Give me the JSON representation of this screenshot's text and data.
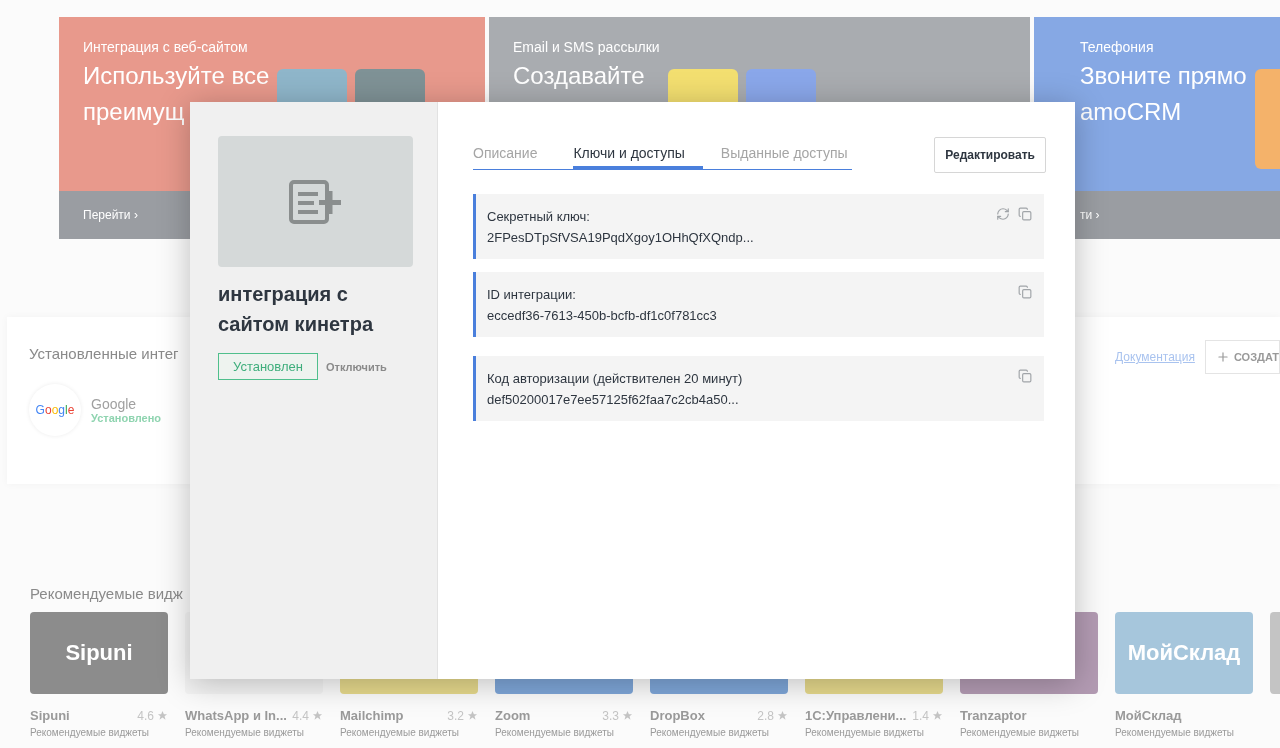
{
  "banners": [
    {
      "category": "Интеграция с веб-сайтом",
      "title_lines": [
        "Используйте все",
        "преимущ"
      ],
      "link": "Перейти ›",
      "color": "#e8998c",
      "logos": [
        {
          "color": "#8fb6ca"
        },
        {
          "color": "#7f9296"
        }
      ]
    },
    {
      "category": "Email и SMS рассылки",
      "title_lines": [
        "Создавайте"
      ],
      "color": "#a9acb0",
      "logos": [
        {
          "color": "#f3df70"
        },
        {
          "color": "#8aa7ea"
        }
      ]
    },
    {
      "category": "Телефония",
      "title_lines": [
        "Звоните прямо",
        "amoCRM"
      ],
      "link": "ти ›",
      "color": "#86a8e4",
      "logos": [
        {
          "color": "#f4b26a"
        }
      ]
    }
  ],
  "installed": {
    "title": "Установленные интег",
    "docs_link": "Документация",
    "create_button": "СОЗДАТ",
    "items": [
      {
        "logo_text": "Google",
        "name": "Google",
        "status": "Установлено"
      }
    ]
  },
  "recommended": {
    "title": "Рекомендуемые видж",
    "widgets": [
      {
        "name": "Sipuni",
        "rating": "4.6",
        "subtitle": "Рекомендуемые виджеты",
        "color": "#8c8c8c",
        "logo_text": "Sipuni"
      },
      {
        "name": "WhatsApp и In...",
        "rating": "4.4",
        "subtitle": "Рекомендуемые виджеты",
        "color": "#f4f4f4"
      },
      {
        "name": "Mailchimp",
        "rating": "3.2",
        "subtitle": "Рекомендуемые виджеты",
        "color": "#e6d98c"
      },
      {
        "name": "Zoom",
        "rating": "3.3",
        "subtitle": "Рекомендуемые виджеты",
        "color": "#7ea6d8"
      },
      {
        "name": "DropBox",
        "rating": "2.8",
        "subtitle": "Рекомендуемые виджеты",
        "color": "#7ea6d8"
      },
      {
        "name": "1С:Управлени...",
        "rating": "1.4",
        "subtitle": "Рекомендуемые виджеты",
        "color": "#e6d98c"
      },
      {
        "name": "Tranzaptor",
        "subtitle": "Рекомендуемые виджеты",
        "color": "#b39bb3"
      },
      {
        "name": "МойСклад",
        "subtitle": "Рекомендуемые виджеты",
        "color": "#a6c6dc",
        "logo_text": "МойСклад"
      },
      {
        "color": "#c4c4c4"
      }
    ]
  },
  "modal": {
    "title": "интеграция с сайтом кинетра",
    "status": "Установлен",
    "disable_link": "Отключить",
    "tabs": [
      {
        "label": "Описание",
        "selected": false
      },
      {
        "label": "Ключи и доступы",
        "selected": true
      },
      {
        "label": "Выданные доступы",
        "selected": false
      }
    ],
    "edit_button": "Редактировать",
    "keys": [
      {
        "label": "Секретный ключ:",
        "value": "2FPesDTpSfVSA19PqdXgoy1OHhQfXQndp...",
        "refreshable": true
      },
      {
        "label": "ID интеграции:",
        "value": "eccedf36-7613-450b-bcfb-df1c0f781cc3",
        "refreshable": false
      },
      {
        "label": "Код авторизации (действителен 20 минут)",
        "value": "def50200017e7ee57125f62faa7c2cb4a50...",
        "refreshable": false
      }
    ]
  }
}
